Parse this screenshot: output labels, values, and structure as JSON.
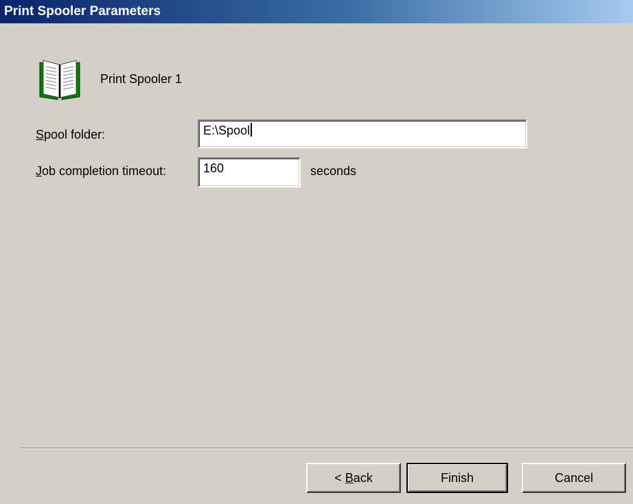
{
  "window": {
    "title": "Print Spooler Parameters"
  },
  "header": {
    "icon": "open-book-icon",
    "label": "Print Spooler 1"
  },
  "form": {
    "spool_folder": {
      "label_accel": "S",
      "label_rest": "pool folder:",
      "value": "E:\\Spool"
    },
    "job_timeout": {
      "label_accel": "J",
      "label_rest": "ob completion timeout:",
      "value": "160",
      "suffix": "seconds"
    }
  },
  "buttons": {
    "back_prefix": "< ",
    "back_accel": "B",
    "back_rest": "ack",
    "finish": "Finish",
    "cancel": "Cancel"
  },
  "colors": {
    "window_bg": "#d4d0c8",
    "title_start": "#0a246a",
    "title_end": "#a6caf0",
    "icon_green": "#008000"
  }
}
